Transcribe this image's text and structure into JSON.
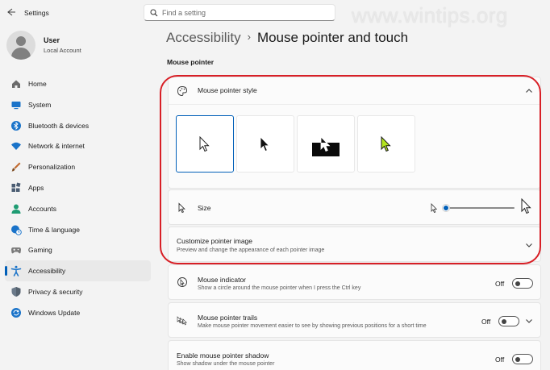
{
  "window": {
    "title": "Settings",
    "back_icon": "back-arrow-icon"
  },
  "search": {
    "placeholder": "Find a setting"
  },
  "watermark": "www.wintips.org",
  "user": {
    "name": "User",
    "account": "Local Account"
  },
  "sidebar": {
    "items": [
      {
        "label": "Home",
        "icon": "home-icon",
        "color": "#6b6b6b"
      },
      {
        "label": "System",
        "icon": "system-icon",
        "color": "#1a73c9"
      },
      {
        "label": "Bluetooth & devices",
        "icon": "bluetooth-icon",
        "color": "#1a73c9"
      },
      {
        "label": "Network & internet",
        "icon": "wifi-icon",
        "color": "#1a73c9"
      },
      {
        "label": "Personalization",
        "icon": "brush-icon",
        "color": "#c26a2f"
      },
      {
        "label": "Apps",
        "icon": "apps-icon",
        "color": "#4b5d73"
      },
      {
        "label": "Accounts",
        "icon": "accounts-icon",
        "color": "#1f9c73"
      },
      {
        "label": "Time & language",
        "icon": "globe-clock-icon",
        "color": "#1a73c9"
      },
      {
        "label": "Gaming",
        "icon": "gamepad-icon",
        "color": "#7b7b7b"
      },
      {
        "label": "Accessibility",
        "icon": "accessibility-icon",
        "color": "#1a73c9"
      },
      {
        "label": "Privacy & security",
        "icon": "shield-icon",
        "color": "#6b7a8a"
      },
      {
        "label": "Windows Update",
        "icon": "update-icon",
        "color": "#1a73c9"
      }
    ],
    "active_index": 9,
    "accent": "#005fb8"
  },
  "breadcrumb": {
    "parent": "Accessibility",
    "separator": "›",
    "current": "Mouse pointer and touch"
  },
  "section": {
    "title": "Mouse pointer"
  },
  "pointer_style": {
    "title": "Mouse pointer style",
    "icon": "palette-icon",
    "expanded": true,
    "styles": [
      "white",
      "black",
      "inverted",
      "custom"
    ],
    "selected_style": "white",
    "custom_color": "#b4e61e"
  },
  "size": {
    "title": "Size",
    "slider_value": 1
  },
  "customize": {
    "title": "Customize pointer image",
    "desc": "Preview and change the appearance of each pointer image"
  },
  "mouse_indicator": {
    "title": "Mouse indicator",
    "desc": "Show a circle around the mouse pointer when I press the Ctrl key",
    "state": "Off"
  },
  "pointer_trails": {
    "title": "Mouse pointer trails",
    "desc": "Make mouse pointer movement easier to see by showing previous positions for a short time",
    "state": "Off"
  },
  "pointer_shadow": {
    "title": "Enable mouse pointer shadow",
    "desc": "Show shadow under the mouse pointer",
    "state": "Off"
  },
  "annotation_color": "#d81f26"
}
